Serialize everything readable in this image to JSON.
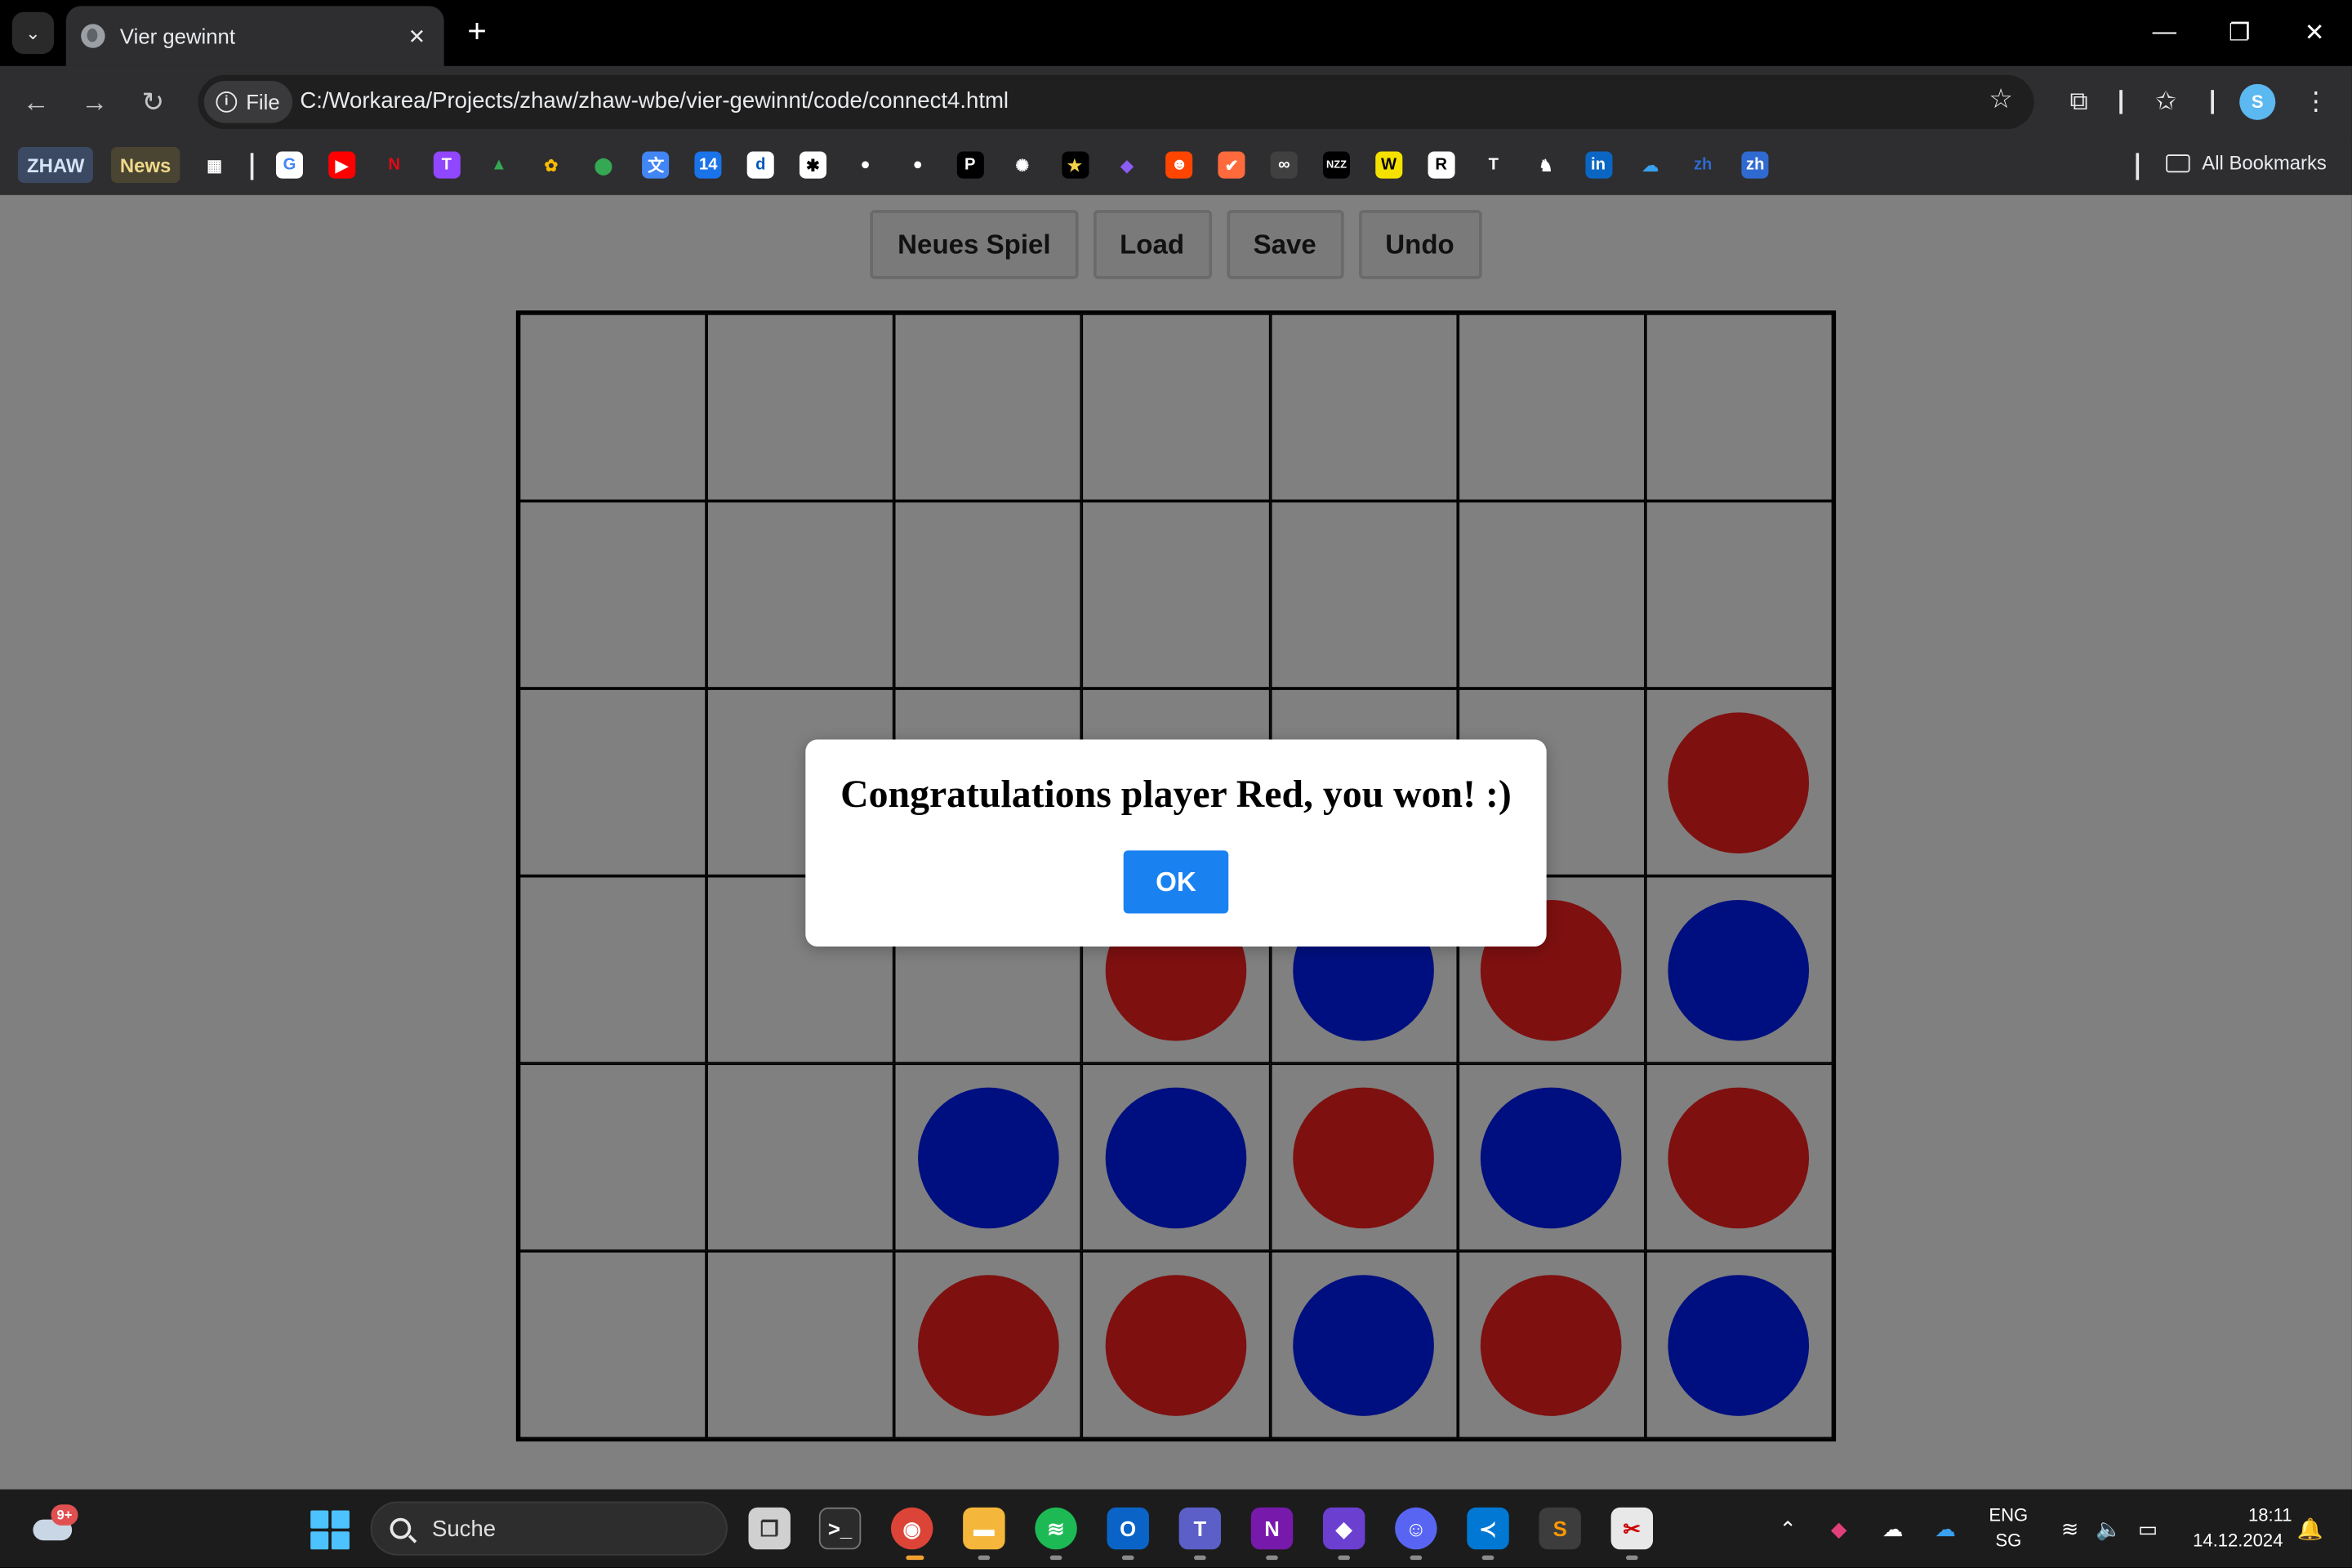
{
  "browser": {
    "tab_title": "Vier gewinnt",
    "tab_close": "✕",
    "new_tab": "+",
    "window_controls": {
      "minimize": "—",
      "restore": "❐",
      "close": "✕"
    },
    "site_chip_label": "File",
    "url": "C:/Workarea/Projects/zhaw/zhaw-wbe/vier-gewinnt/code/connect4.html",
    "profile_initial": "S"
  },
  "bookmarks": {
    "chips": [
      {
        "label": "ZHAW",
        "bg": "#3b4a62",
        "fg": "#d6e2f5"
      },
      {
        "label": "News",
        "bg": "#4a4432",
        "fg": "#f0d98a"
      }
    ],
    "icons": [
      {
        "name": "apps-grid-icon",
        "glyph": "▦",
        "bg": "transparent"
      },
      {
        "name": "google-icon",
        "glyph": "G",
        "bg": "#ffffff",
        "fg": "#4285f4"
      },
      {
        "name": "youtube-icon",
        "glyph": "▶",
        "bg": "#ff0000"
      },
      {
        "name": "netflix-icon",
        "glyph": "N",
        "bg": "transparent",
        "fg": "#e50914"
      },
      {
        "name": "twitch-icon",
        "glyph": "T",
        "bg": "#9146ff"
      },
      {
        "name": "google-drive-icon",
        "glyph": "▲",
        "bg": "transparent",
        "fg": "#34a853"
      },
      {
        "name": "google-photos-icon",
        "glyph": "✿",
        "bg": "transparent",
        "fg": "#fbbc05"
      },
      {
        "name": "google-maps-icon",
        "glyph": "⬤",
        "bg": "transparent",
        "fg": "#34a853"
      },
      {
        "name": "google-translate-icon",
        "glyph": "文",
        "bg": "#4285f4"
      },
      {
        "name": "google-calendar-icon",
        "glyph": "14",
        "bg": "#1a73e8"
      },
      {
        "name": "dict-icon",
        "glyph": "d",
        "bg": "#ffffff",
        "fg": "#0057b8"
      },
      {
        "name": "puzzle-icon",
        "glyph": "✱",
        "bg": "#ffffff",
        "fg": "#000000"
      },
      {
        "name": "github-icon",
        "glyph": "●",
        "bg": "transparent",
        "fg": "#ffffff"
      },
      {
        "name": "github-alt-icon",
        "glyph": "●",
        "bg": "transparent",
        "fg": "#ffffff"
      },
      {
        "name": "pocket-p-icon",
        "glyph": "P",
        "bg": "#000000"
      },
      {
        "name": "chatgpt-icon",
        "glyph": "✺",
        "bg": "transparent",
        "fg": "#ffffff"
      },
      {
        "name": "star-app-icon",
        "glyph": "★",
        "bg": "#000000",
        "fg": "#f3d34a"
      },
      {
        "name": "obsidian-icon",
        "glyph": "◆",
        "bg": "transparent",
        "fg": "#8b5cf6"
      },
      {
        "name": "reddit-icon",
        "glyph": "☻",
        "bg": "#ff4500"
      },
      {
        "name": "check-app-icon",
        "glyph": "✔",
        "bg": "#ff6a3d"
      },
      {
        "name": "olympics-icon",
        "glyph": "∞",
        "bg": "#404040"
      },
      {
        "name": "nzz-icon",
        "glyph": "NZZ",
        "bg": "#000000"
      },
      {
        "name": "w-news-icon",
        "glyph": "W",
        "bg": "#f5e100",
        "fg": "#000000"
      },
      {
        "name": "republik-icon",
        "glyph": "R",
        "bg": "#ffffff",
        "fg": "#000000"
      },
      {
        "name": "nyt-icon",
        "glyph": "T",
        "bg": "transparent",
        "fg": "#ffffff"
      },
      {
        "name": "duck-icon",
        "glyph": "♞",
        "bg": "transparent",
        "fg": "#ffffff"
      },
      {
        "name": "linkedin-icon",
        "glyph": "in",
        "bg": "#0a66c2"
      },
      {
        "name": "onedrive-icon",
        "glyph": "☁",
        "bg": "transparent",
        "fg": "#3aa0f0"
      },
      {
        "name": "zhaw-icon",
        "glyph": "zh",
        "bg": "transparent",
        "fg": "#2f6ad0"
      },
      {
        "name": "zhaw-alt-icon",
        "glyph": "zh",
        "bg": "#2f6ad0"
      }
    ],
    "all_bookmarks_label": "All Bookmarks"
  },
  "game": {
    "buttons": [
      "Neues Spiel",
      "Load",
      "Save",
      "Undo"
    ],
    "board": [
      [
        "",
        "",
        "",
        "",
        "",
        "",
        ""
      ],
      [
        "",
        "",
        "",
        "",
        "",
        "",
        ""
      ],
      [
        "",
        "",
        "",
        "",
        "",
        "",
        "r"
      ],
      [
        "",
        "",
        "",
        "r",
        "b",
        "r",
        "b"
      ],
      [
        "",
        "",
        "b",
        "b",
        "r",
        "b",
        "r"
      ],
      [
        "",
        "",
        "r",
        "r",
        "b",
        "r",
        "b"
      ]
    ],
    "colors": {
      "red": "#7f1010",
      "blue": "#000f80",
      "background": "#808080"
    },
    "dialog": {
      "message": "Congratulations player Red, you won! :)",
      "ok_label": "OK"
    }
  },
  "taskbar": {
    "weather_badge": "9+",
    "search_placeholder": "Suche",
    "language": "ENG",
    "region": "SG",
    "time": "18:11",
    "date": "14.12.2024"
  }
}
